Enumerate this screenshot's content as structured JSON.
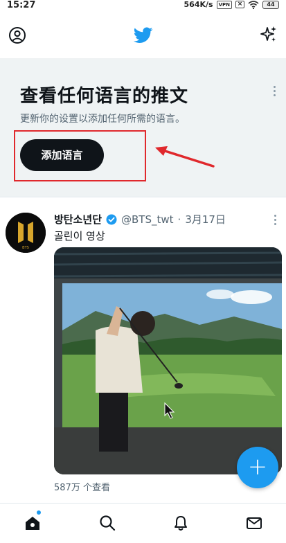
{
  "status_bar": {
    "time": "15:27",
    "speed": "564K/s",
    "vpn": "VPN",
    "battery": "44"
  },
  "header": {
    "profile_icon": "profile-icon",
    "logo_icon": "twitter-bird-icon",
    "sparkle_icon": "sparkle-icon",
    "brand_color": "#1d9bf0"
  },
  "promo": {
    "title": "查看任何语言的推文",
    "subtitle": "更新你的设置以添加任何所需的语言。",
    "button_label": "添加语言",
    "annotation_color": "#e0282c"
  },
  "tweet": {
    "author_name": "방탄소년단",
    "handle": "@BTS_twt",
    "separator": "·",
    "date": "3月17日",
    "text": "골린이 영상",
    "views": "587万 个查看",
    "avatar_text": "BTS"
  },
  "fab": {
    "label": "+"
  },
  "bottom_nav": {
    "items": [
      "home-icon",
      "search-icon",
      "notifications-icon",
      "messages-icon"
    ]
  }
}
